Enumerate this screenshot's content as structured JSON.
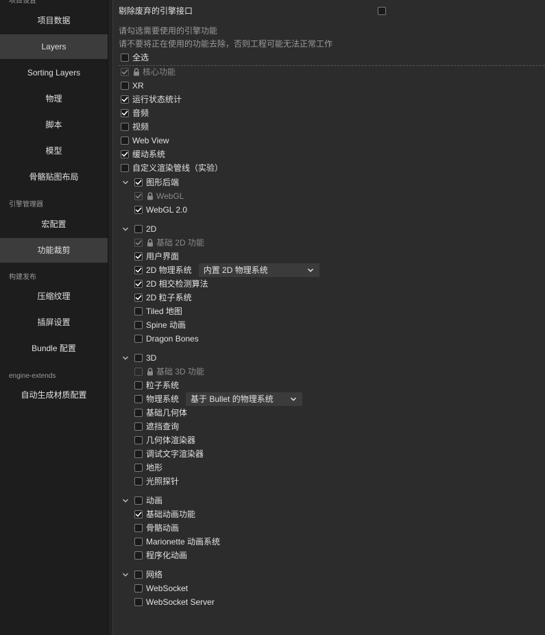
{
  "sidebar": {
    "sections": [
      {
        "title": "项目设置",
        "items": [
          "项目数据",
          "Layers",
          "Sorting Layers",
          "物理",
          "脚本",
          "模型",
          "骨骼贴图布局"
        ]
      },
      {
        "title": "引擎管理器",
        "items": [
          "宏配置",
          "功能裁剪"
        ]
      },
      {
        "title": "构建发布",
        "items": [
          "压缩纹理",
          "插屏设置",
          "Bundle 配置"
        ]
      },
      {
        "title": "engine-extends",
        "items": [
          "自动生成材质配置"
        ]
      }
    ]
  },
  "main": {
    "remove_deprecated_label": "剔除废弃的引擎接口",
    "hint_1": "请勾选需要使用的引擎功能",
    "hint_2": "请不要将正在使用的功能去除，否则工程可能无法正常工作",
    "select_all": "全选",
    "features": [
      {
        "label": "核心功能",
        "checked": true,
        "locked": true
      },
      {
        "label": "XR",
        "checked": false
      },
      {
        "label": "运行状态统计",
        "checked": true
      },
      {
        "label": "音频",
        "checked": true
      },
      {
        "label": "视频",
        "checked": false
      },
      {
        "label": "Web View",
        "checked": false
      },
      {
        "label": "缓动系统",
        "checked": true
      },
      {
        "label": "自定义渲染管线（实验）",
        "checked": false
      }
    ],
    "groups": [
      {
        "label": "图形后端",
        "checked": true,
        "children": [
          {
            "label": "WebGL",
            "checked": true,
            "locked": true
          },
          {
            "label": "WebGL 2.0",
            "checked": true
          }
        ]
      },
      {
        "label": "2D",
        "checked": false,
        "children": [
          {
            "label": "基础 2D 功能",
            "checked": true,
            "locked": true
          },
          {
            "label": "用户界面",
            "checked": true
          },
          {
            "label": "2D 物理系统",
            "checked": true,
            "select": "内置 2D 物理系统"
          },
          {
            "label": "2D 相交检测算法",
            "checked": true
          },
          {
            "label": "2D 粒子系统",
            "checked": true
          },
          {
            "label": "Tiled 地图",
            "checked": false
          },
          {
            "label": "Spine 动画",
            "checked": false
          },
          {
            "label": "Dragon Bones",
            "checked": false
          }
        ]
      },
      {
        "label": "3D",
        "checked": false,
        "children": [
          {
            "label": "基础 3D 功能",
            "checked": false,
            "locked": true
          },
          {
            "label": "粒子系统",
            "checked": false
          },
          {
            "label": "物理系统",
            "checked": false,
            "select": "基于 Bullet 的物理系统"
          },
          {
            "label": "基础几何体",
            "checked": false
          },
          {
            "label": "遮挡查询",
            "checked": false
          },
          {
            "label": "几何体渲染器",
            "checked": false
          },
          {
            "label": "调试文字渲染器",
            "checked": false
          },
          {
            "label": "地形",
            "checked": false
          },
          {
            "label": "光照探针",
            "checked": false
          }
        ]
      },
      {
        "label": "动画",
        "checked": false,
        "children": [
          {
            "label": "基础动画功能",
            "checked": true
          },
          {
            "label": "骨骼动画",
            "checked": false
          },
          {
            "label": "Marionette 动画系统",
            "checked": false
          },
          {
            "label": "程序化动画",
            "checked": false
          }
        ]
      },
      {
        "label": "网络",
        "checked": false,
        "children": [
          {
            "label": "WebSocket",
            "checked": false
          },
          {
            "label": "WebSocket Server",
            "checked": false
          }
        ]
      }
    ]
  }
}
